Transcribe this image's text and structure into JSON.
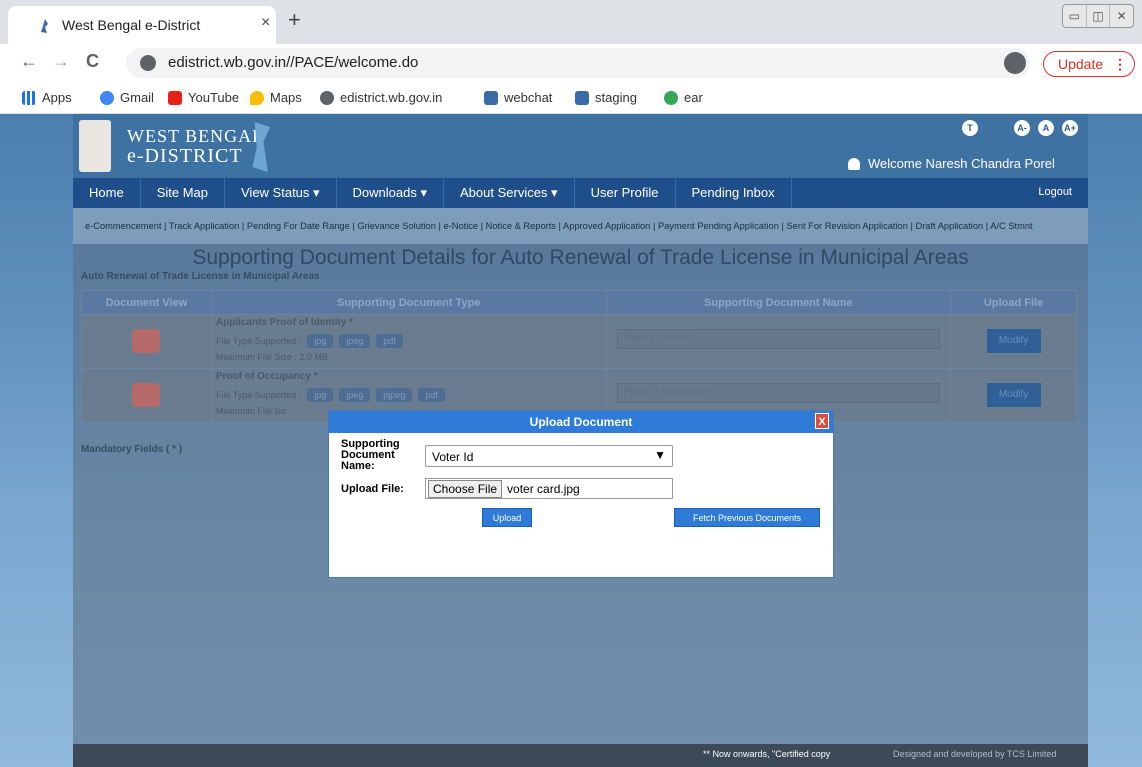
{
  "browser": {
    "tab_title": "West Bengal e-District",
    "tab_close": "×",
    "new_tab": "+",
    "back": "←",
    "forward": "→",
    "reload": "C",
    "url": "edistrict.wb.gov.in//PACE/welcome.do",
    "update_label": "Update",
    "update_menu": "⋮",
    "window_controls": [
      "▭",
      "◫",
      "✕"
    ],
    "bookmarks": [
      "Apps",
      "Gmail",
      "YouTube",
      "Maps",
      "edistrict.wb.gov.in",
      "webchat",
      "staging",
      "ear"
    ]
  },
  "header": {
    "brand_line1": "WEST BENGAL",
    "brand_line2": "e-DISTRICT",
    "text_size_buttons": [
      "T",
      "A-",
      "A",
      "A+"
    ],
    "welcome": "Welcome Naresh Chandra Porel"
  },
  "nav": {
    "items": [
      "Home",
      "Site Map",
      "View Status ▾",
      "Downloads ▾",
      "About Services ▾",
      "User Profile",
      "Pending Inbox"
    ],
    "logout": "Logout"
  },
  "subnav": "e-Commencement | Track Application | Pending For Date Range | Grievance Solution | e-Notice | Notice & Reports | Approved Application | Payment Pending Application | Sent For Revision Application | Draft Application | A/C Stmnt",
  "content": {
    "title": "Supporting Document Details for Auto Renewal of Trade License in Municipal Areas",
    "subtitle": "Auto Renewal of Trade License in Municipal Areas",
    "columns": [
      "Document View",
      "Supporting Document Type",
      "Supporting Document Name",
      "Upload File"
    ],
    "rows": [
      {
        "type": "Applicants Proof of Identity *",
        "filetype_label": "File Type Supported :",
        "filetypes": [
          "jpg",
          "jpeg",
          "pdf"
        ],
        "max_size": "Maximum File Size : 2.0 MB",
        "doc_name": "Driving Licence",
        "action": "Modify"
      },
      {
        "type": "Proof of Occupancy *",
        "filetype_label": "File Type Supported :",
        "filetypes": [
          "jpg",
          "jpeg",
          "pjpeg",
          "pdf"
        ],
        "max_size": "Maximum File Siz",
        "doc_name": "Proof of Occupancy",
        "action": "Modify"
      }
    ],
    "mandatory": "Mandatory Fields ( * )"
  },
  "footer": {
    "note": "** Now onwards, \"Certified copy",
    "credit": "Designed and developed by TCS Limited"
  },
  "modal": {
    "title": "Upload Document",
    "close": "X",
    "doc_name_label": "Supporting Document Name:",
    "doc_name_value": "Voter Id",
    "upload_file_label": "Upload File:",
    "choose_file": "Choose File",
    "file_name": "voter card.jpg",
    "upload_button": "Upload",
    "fetch_button": "Fetch Previous Documents"
  }
}
